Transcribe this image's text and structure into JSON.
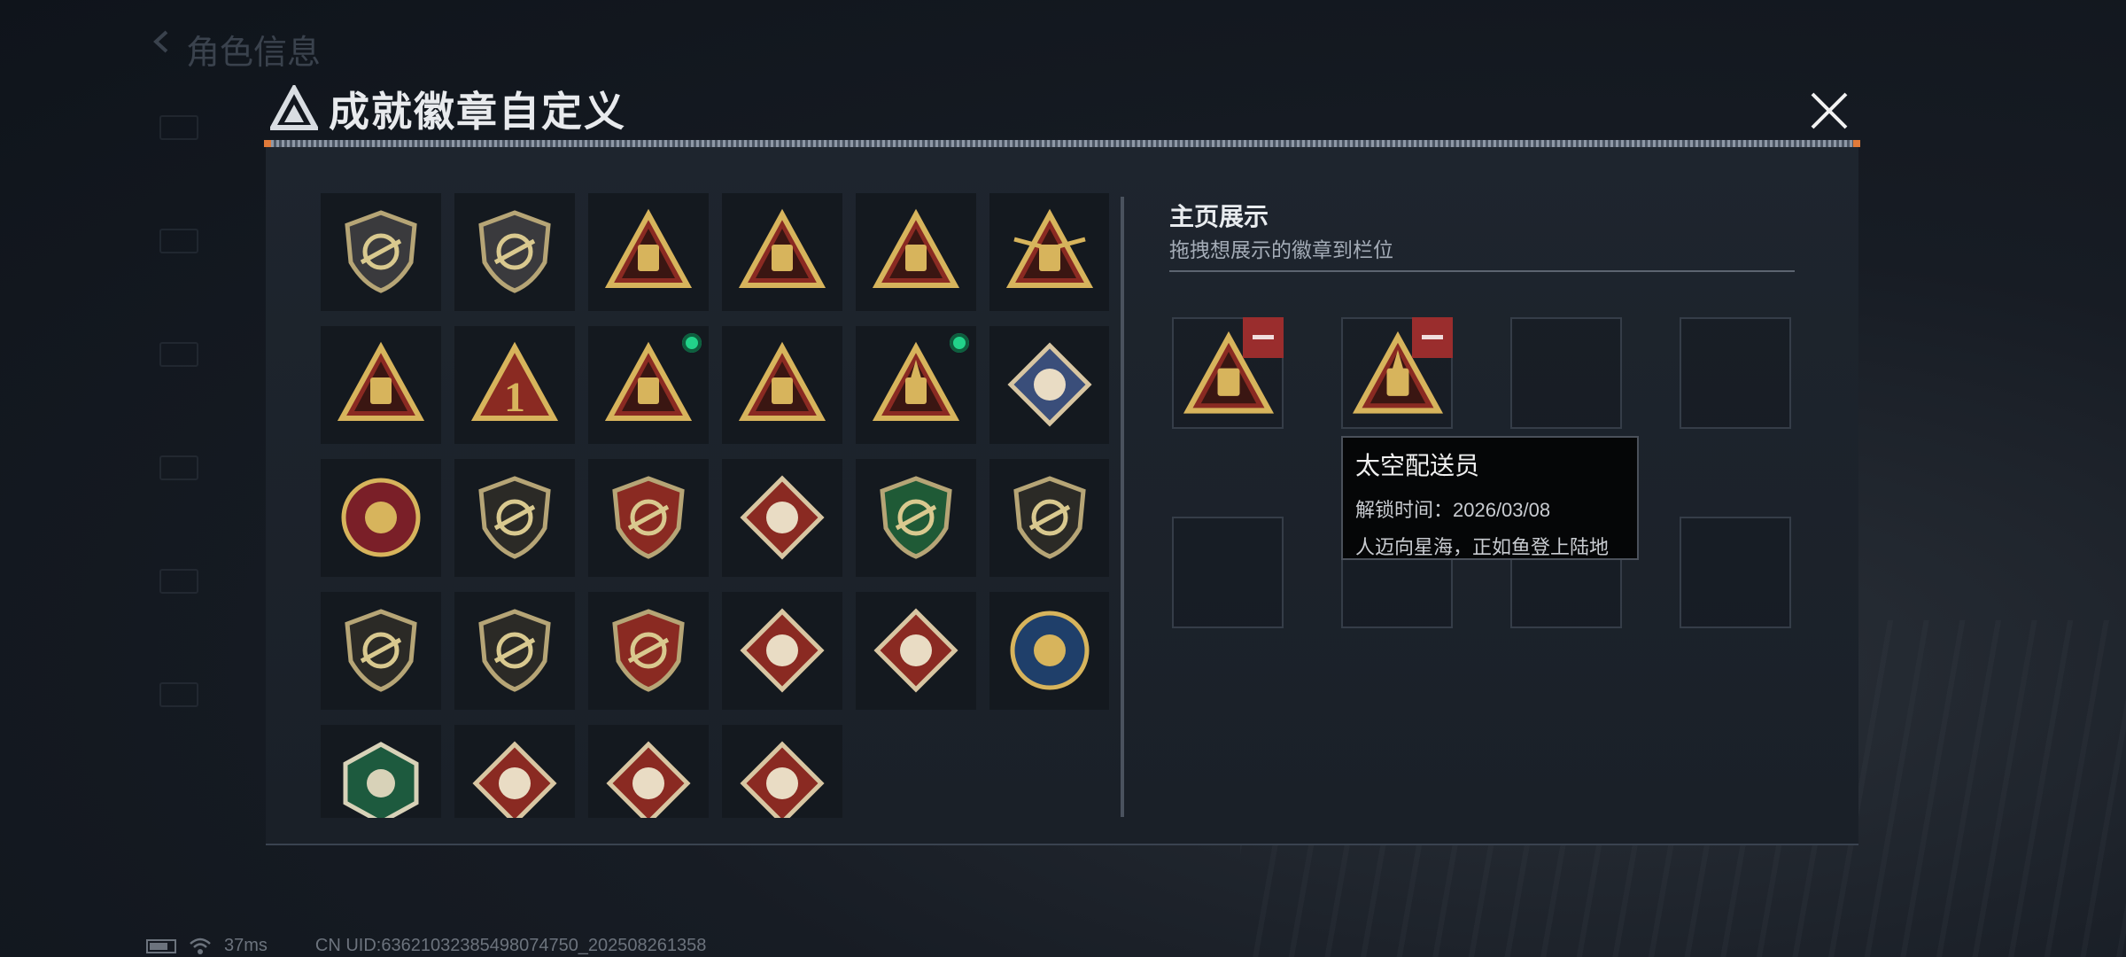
{
  "background": {
    "page_title": "角色信息"
  },
  "dialog": {
    "title": "成就徽章自定义"
  },
  "badges": [
    {
      "icon": "apex-shield-badge-icon"
    },
    {
      "icon": "helicopter-shield-badge-icon"
    },
    {
      "icon": "backpack-55-badge-icon"
    },
    {
      "icon": "backpack-57-badge-icon"
    },
    {
      "icon": "backpack-58-badge-icon"
    },
    {
      "icon": "winged-59-badge-icon"
    },
    {
      "icon": "boat-triangle-badge-icon"
    },
    {
      "icon": "number-one-triangle-badge-icon"
    },
    {
      "icon": "usb-triangle-badge-icon",
      "new": true
    },
    {
      "icon": "soldiers-triangle-badge-icon"
    },
    {
      "icon": "rocket-triangle-badge-icon",
      "new": true
    },
    {
      "icon": "fist-diamond-badge-icon"
    },
    {
      "icon": "star-wheel-badge-icon"
    },
    {
      "icon": "chevron-shield-badge-icon"
    },
    {
      "icon": "stars-crest-badge-icon"
    },
    {
      "icon": "diamond-crest-badge-icon"
    },
    {
      "icon": "green-rifle-crest-badge-icon"
    },
    {
      "icon": "rifle-shield-badge-icon"
    },
    {
      "icon": "rifle-shield-badge-2-icon"
    },
    {
      "icon": "sniper-shield-badge-icon"
    },
    {
      "icon": "crossed-missiles-badge-icon"
    },
    {
      "icon": "wolf-diamond-badge-icon"
    },
    {
      "icon": "wolf-diamond-badge-2-icon"
    },
    {
      "icon": "eagle-round-badge-icon"
    },
    {
      "icon": "dragonfly-hex-badge-icon"
    },
    {
      "icon": "dragon-diamond-badge-icon"
    },
    {
      "icon": "dragon-diamond-badge-2-icon"
    },
    {
      "icon": "runner-diamond-badge-icon"
    }
  ],
  "showcase": {
    "title": "主页展示",
    "subtitle": "拖拽想展示的徽章到栏位",
    "slots": [
      {
        "icon": "usb-triangle-badge-icon"
      },
      {
        "icon": "rocket-triangle-badge-icon"
      },
      {},
      {},
      {},
      {},
      {},
      {}
    ]
  },
  "tooltip": {
    "name": "太空配送员",
    "unlock_line": "解锁时间：2026/03/08",
    "description": "人迈向星海，正如鱼登上陆地"
  },
  "status_bar": {
    "ping": "37ms",
    "uid": "CN UID:636210323854980747​50_202508261358"
  },
  "colors": {
    "gold": "#d7b45c",
    "badge_red": "#8a2a22",
    "new_dot": "#22d38a",
    "remove": "#9a2d2d"
  }
}
